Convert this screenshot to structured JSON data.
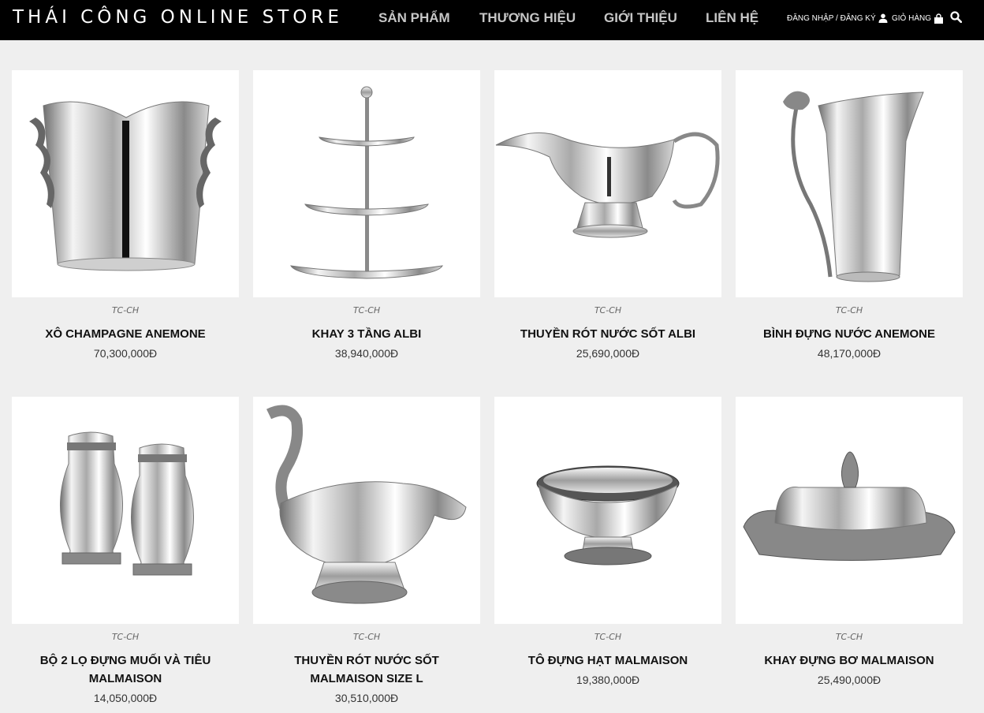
{
  "header": {
    "brand": "THÁI CÔNG ONLINE STORE",
    "nav": [
      "SẢN PHẨM",
      "THƯƠNG HIỆU",
      "GIỚI THIỆU",
      "LIÊN HỆ"
    ],
    "login_label": "ĐĂNG NHẬP / ĐĂNG KÝ",
    "cart_label": "GIỎ HÀNG"
  },
  "products": [
    {
      "sku": "TC-CH",
      "name": "XÔ CHAMPAGNE ANEMONE",
      "price": "70,300,000Đ",
      "image": "champagne-bucket"
    },
    {
      "sku": "TC-CH",
      "name": "KHAY 3 TẦNG ALBI",
      "price": "38,940,000Đ",
      "image": "three-tier-tray"
    },
    {
      "sku": "TC-CH",
      "name": "THUYỀN RÓT NƯỚC SỐT ALBI",
      "price": "25,690,000Đ",
      "image": "sauce-boat"
    },
    {
      "sku": "TC-CH",
      "name": "BÌNH ĐỰNG NƯỚC ANEMONE",
      "price": "48,170,000Đ",
      "image": "water-pitcher"
    },
    {
      "sku": "TC-CH",
      "name": "BỘ 2 LỌ ĐỰNG MUỐI VÀ TIÊU MALMAISON",
      "price": "14,050,000Đ",
      "image": "salt-pepper-shakers"
    },
    {
      "sku": "TC-CH",
      "name": "THUYỀN RÓT NƯỚC SỐT MALMAISON SIZE L",
      "price": "30,510,000Đ",
      "image": "swan-sauce-boat"
    },
    {
      "sku": "TC-CH",
      "name": "TÔ ĐỰNG HẠT MALMAISON",
      "price": "19,380,000Đ",
      "image": "footed-bowl"
    },
    {
      "sku": "TC-CH",
      "name": "KHAY ĐỰNG BƠ MALMAISON",
      "price": "25,490,000Đ",
      "image": "butter-dish"
    }
  ]
}
